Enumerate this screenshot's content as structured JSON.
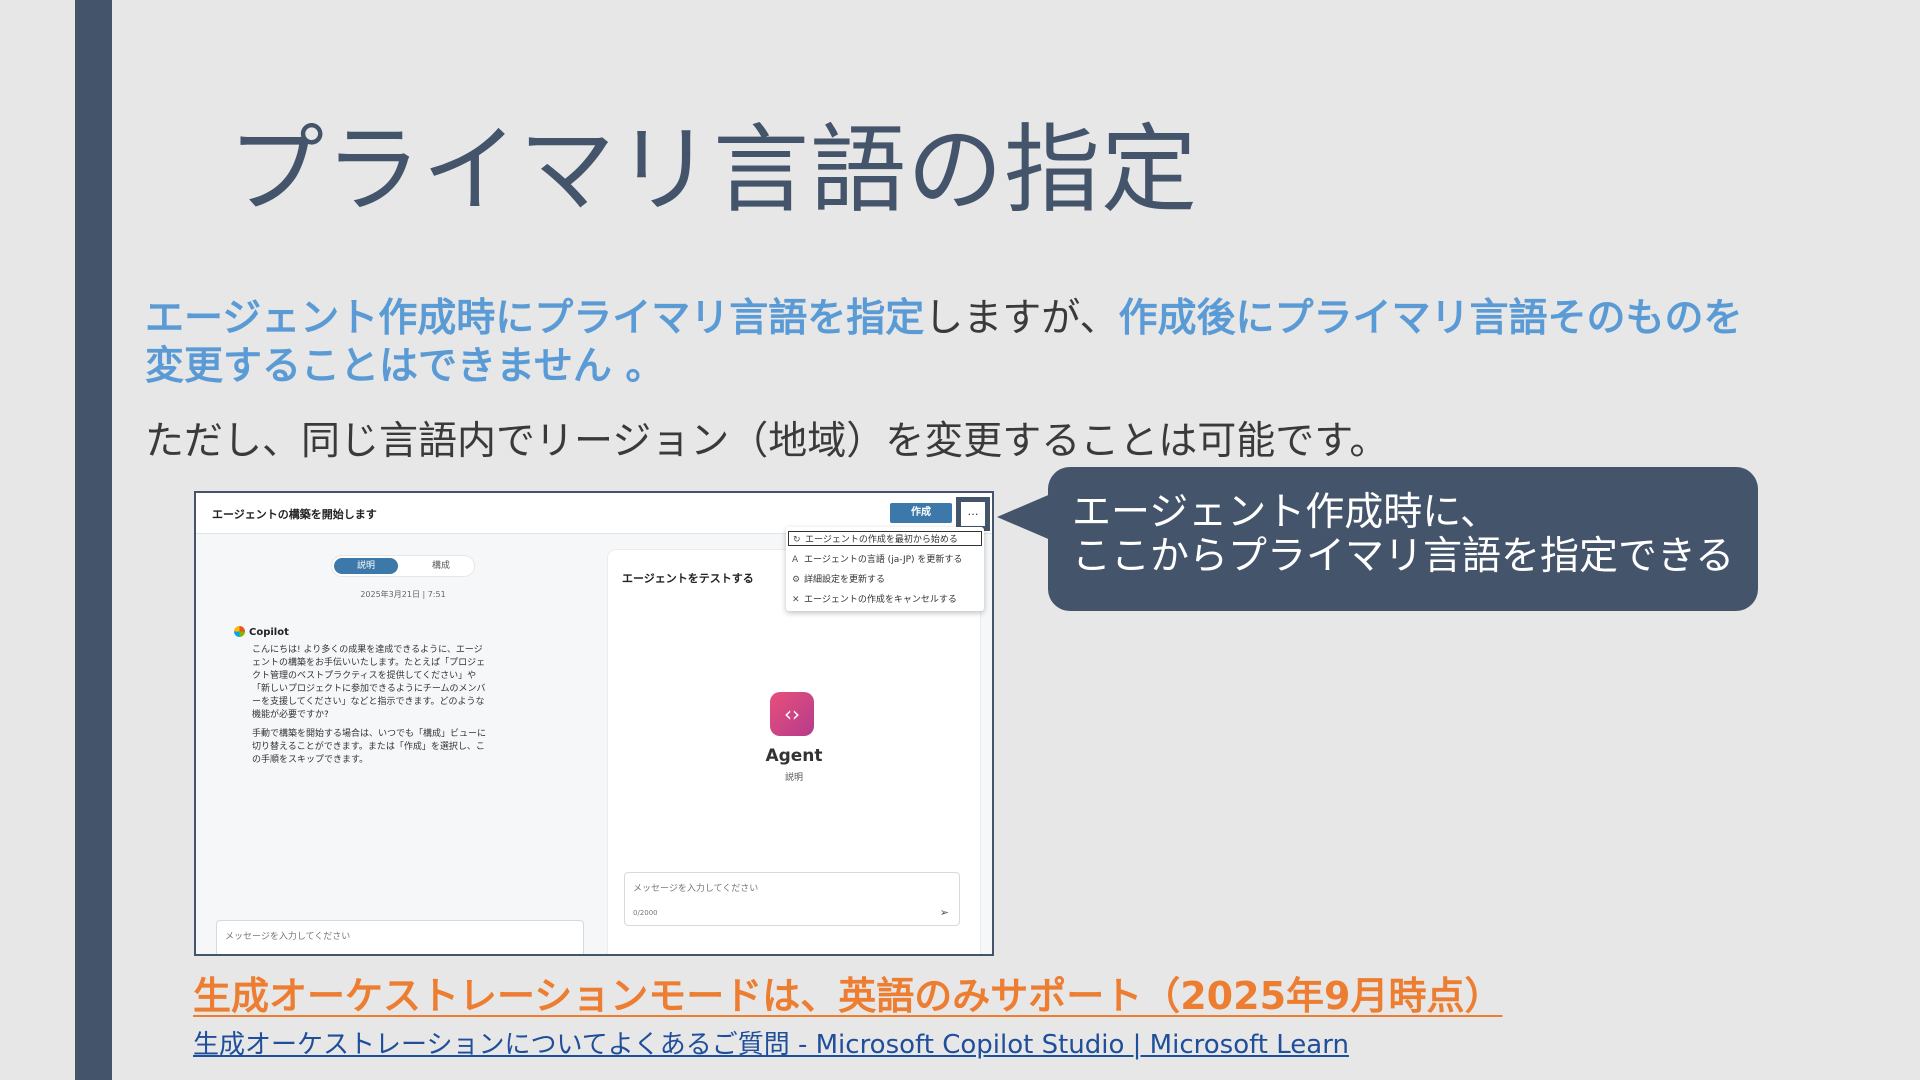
{
  "slide": {
    "title": "プライマリ言語の指定",
    "para1_hl1": "エージェント作成時にプライマリ言語を指定",
    "para1_normal": "しますが、",
    "para1_hl2": "作成後にプライマリ言語そのものを変更することはできません 。",
    "para2": "ただし、同じ言語内でリージョン（地域）を変更することは可能です。",
    "callout_line1": "エージェント作成時に、",
    "callout_line2": "ここからプライマリ言語を指定できる",
    "orange_note": "生成オーケストレーションモードは、英語のみサポート（2025年9月時点）",
    "link_text": "生成オーケストレーションについてよくあるご質問 - Microsoft Copilot Studio | Microsoft Learn"
  },
  "screenshot": {
    "header_title": "エージェントの構築を開始します",
    "create_label": "作成",
    "more_label": "…",
    "toggle_on": "説明",
    "toggle_off": "構成",
    "date": "2025年3月21日 | 7:51",
    "copilot_label": "Copilot",
    "chat_p1": "こんにちは! より多くの成果を達成できるように、エージェントの構築をお手伝いいたします。たとえば「プロジェクト管理のベストプラクティスを提供してください」や「新しいプロジェクトに参加できるようにチームのメンバーを支援してください」などと指示できます。どのような機能が必要ですか?",
    "chat_p2": "手動で構築を開始する場合は、いつでも「構成」ビューに切り替えることができます。または「作成」を選択し、この手順をスキップできます。",
    "left_placeholder": "メッセージを入力してください",
    "test_title": "エージェントをテストする",
    "agent_name": "Agent",
    "agent_desc": "説明",
    "right_placeholder": "メッセージを入力してください",
    "counter": "0/2000",
    "menu": [
      "エージェントの作成を最初から始める",
      "エージェントの言語 (ja-JP) を更新する",
      "詳細設定を更新する",
      "エージェントの作成をキャンセルする"
    ]
  },
  "colors": {
    "background": "#e7e7e7",
    "accent_dark": "#44546a",
    "highlight_blue": "#5b9bd5",
    "orange": "#ed7d31",
    "link": "#1f4e9a"
  }
}
